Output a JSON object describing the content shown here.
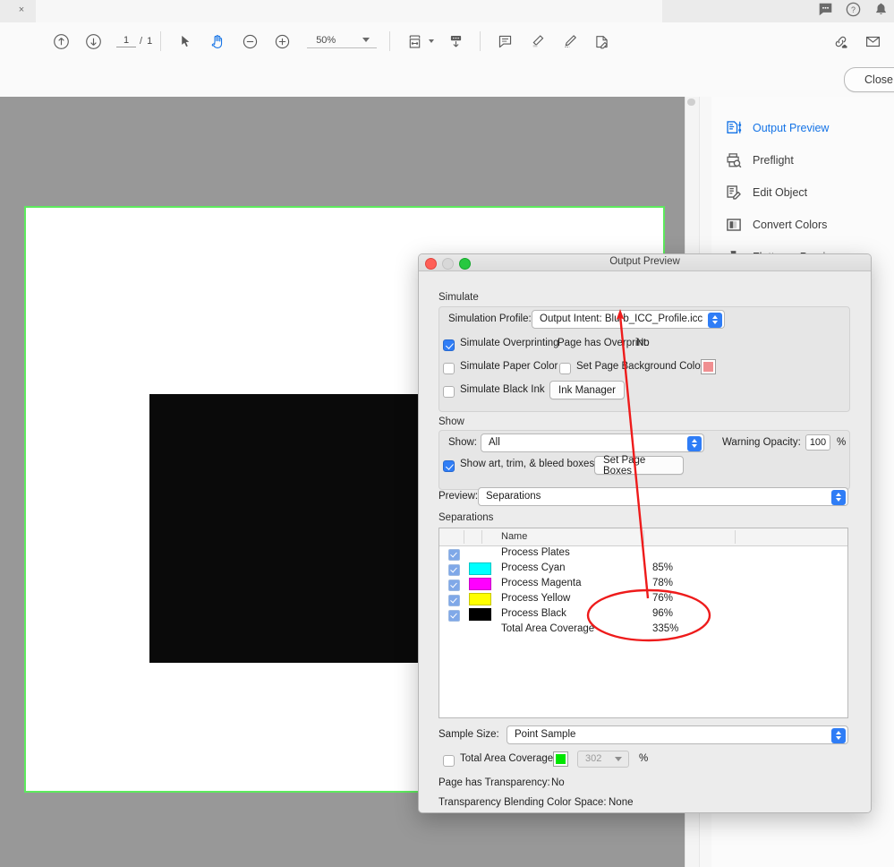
{
  "window": {
    "tab_close_label": "×"
  },
  "chrome": {
    "icons": [
      {
        "name": "comment-icon",
        "label": "Comment"
      },
      {
        "name": "help-icon",
        "label": "Help"
      },
      {
        "name": "bell-icon",
        "label": "Notifications"
      }
    ]
  },
  "toolbar": {
    "prev_page_label": "Previous Page",
    "next_page_label": "Next Page",
    "page_current": "1",
    "page_separator": "/",
    "page_total": "1",
    "select_tool_label": "Select",
    "hand_tool_label": "Hand Tool",
    "zoom_out_label": "Zoom Out",
    "zoom_in_label": "Zoom In",
    "zoom_value": "50%",
    "fit_page_label": "Fit Page",
    "scroll_mode_label": "Page Display",
    "comment_label": "Add Comment",
    "highlight_label": "Highlight Text",
    "draw_label": "Draw",
    "stamp_label": "Add Stamp",
    "share_link_label": "Share Link",
    "email_label": "Email"
  },
  "subbar": {
    "close_label": "Close"
  },
  "sidebar": {
    "items": [
      {
        "label": "Output Preview",
        "icon": "output-preview-icon",
        "active": true
      },
      {
        "label": "Preflight",
        "icon": "preflight-icon",
        "active": false
      },
      {
        "label": "Edit Object",
        "icon": "edit-object-icon",
        "active": false
      },
      {
        "label": "Convert Colors",
        "icon": "convert-colors-icon",
        "active": false
      },
      {
        "label": "Flattener Preview",
        "icon": "flattener-preview-icon",
        "active": false
      }
    ]
  },
  "dialog": {
    "title": "Output Preview",
    "simulate": {
      "group_label": "Simulate",
      "profile_label": "Simulation Profile:",
      "profile_value": "Output Intent: Blurb_ICC_Profile.icc",
      "simulate_overprinting_label": "Simulate Overprinting",
      "simulate_overprinting_checked": true,
      "page_has_overprint_label": "Page has Overprint:",
      "page_has_overprint_value": "No",
      "simulate_paper_color_label": "Simulate Paper Color",
      "simulate_paper_color_checked": false,
      "set_page_background_label": "Set Page Background Color",
      "set_page_background_checked": false,
      "page_background_swatch_color": "#f08f91",
      "simulate_black_ink_label": "Simulate Black Ink",
      "simulate_black_ink_checked": false,
      "ink_manager_label": "Ink Manager"
    },
    "show": {
      "group_label": "Show",
      "show_label": "Show:",
      "show_value": "All",
      "warning_opacity_label": "Warning Opacity:",
      "warning_opacity_value": "100",
      "warning_opacity_unit": "%",
      "show_boxes_label": "Show art, trim, & bleed boxes",
      "show_boxes_checked": true,
      "set_page_boxes_label": "Set Page Boxes"
    },
    "preview": {
      "preview_label": "Preview:",
      "preview_value": "Separations"
    },
    "separations": {
      "group_label": "Separations",
      "columns": [
        "",
        "",
        "Name",
        "",
        ""
      ],
      "rows": [
        {
          "checked": true,
          "swatch": null,
          "name": "Process Plates",
          "percent": ""
        },
        {
          "checked": true,
          "swatch": "#00ffff",
          "name": "Process Cyan",
          "percent": "85%"
        },
        {
          "checked": true,
          "swatch": "#ff00ff",
          "name": "Process Magenta",
          "percent": "78%"
        },
        {
          "checked": true,
          "swatch": "#ffff00",
          "name": "Process Yellow",
          "percent": "76%"
        },
        {
          "checked": true,
          "swatch": "#000000",
          "name": "Process Black",
          "percent": "96%"
        },
        {
          "checked": null,
          "swatch": null,
          "name": "Total Area Coverage",
          "percent": "335%"
        }
      ]
    },
    "footer": {
      "sample_size_label": "Sample Size:",
      "sample_size_value": "Point Sample",
      "total_area_coverage_label": "Total Area Coverage",
      "total_area_coverage_checked": false,
      "total_area_coverage_swatch": "#00e600",
      "total_area_coverage_value": "302",
      "total_area_coverage_unit": "%",
      "page_has_transparency_label": "Page has Transparency:",
      "page_has_transparency_value": "No",
      "blending_space_label": "Transparency Blending Color Space:",
      "blending_space_value": "None"
    }
  },
  "annotation": {
    "color": "#ee1b1b",
    "arrow_name": "red-arrow-annotation",
    "ellipse_name": "red-ellipse-annotation"
  },
  "page_preview": {
    "bleed_box_color": "#5dea5d",
    "background_color": "#989898",
    "black_object_color": "#0a0a0a"
  }
}
